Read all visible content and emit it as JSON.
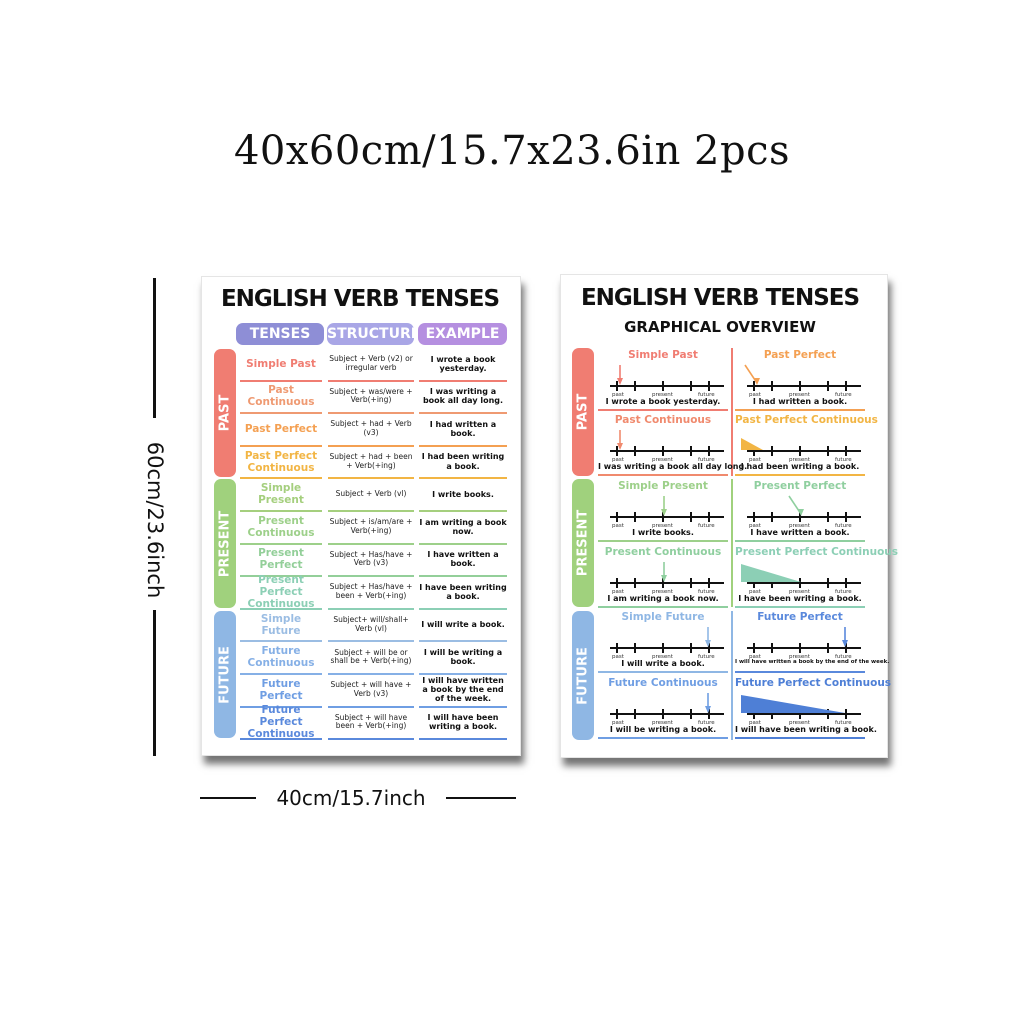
{
  "title": "40x60cm/15.7x23.6in 2pcs",
  "dim_height": "60cm/23.6inch",
  "dim_width": "40cm/15.7inch",
  "colors": {
    "past": "#f07d72",
    "present": "#9fcf82",
    "future": "#8fb7e4",
    "header_tenses": "#8e8ed6",
    "header_structure": "#a9a6e6",
    "header_example": "#b58fe0"
  },
  "poster1": {
    "title": "ENGLISH VERB TENSES",
    "headers": {
      "tenses": "TENSES",
      "structure": "STRUCTURE",
      "example": "EXAMPLE"
    },
    "groups": [
      "PAST",
      "PRESENT",
      "FUTURE"
    ],
    "rows": [
      {
        "name": "Simple Past",
        "structure": "Subject + Verb (v2) or irregular verb",
        "example": "I wrote a book yesterday."
      },
      {
        "name": "Past Continuous",
        "structure": "Subject + was/were + Verb(+ing)",
        "example": "I was writing a book all day long."
      },
      {
        "name": "Past Perfect",
        "structure": "Subject + had + Verb (v3)",
        "example": "I had written a book."
      },
      {
        "name": "Past Perfect Continuous",
        "structure": "Subject + had + been + Verb(+ing)",
        "example": "I had been writing a book."
      },
      {
        "name": "Simple Present",
        "structure": "Subject + Verb (vl)",
        "example": "I write books."
      },
      {
        "name": "Present Continuous",
        "structure": "Subject + is/am/are + Verb(+ing)",
        "example": "I am writing a book now."
      },
      {
        "name": "Present Perfect",
        "structure": "Subject + Has/have + Verb (v3)",
        "example": "I have written a book."
      },
      {
        "name": "Present Perfect Continuous",
        "structure": "Subject + Has/have + been + Verb(+ing)",
        "example": "I have been writing a book."
      },
      {
        "name": "Simple Future",
        "structure": "Subject+ will/shall+ Verb (vl)",
        "example": "I will write a book."
      },
      {
        "name": "Future Continuous",
        "structure": "Subject + will be or shall be + Verb(+ing)",
        "example": "I will be writing a book."
      },
      {
        "name": "Future Perfect",
        "structure": "Subject + will have + Verb (v3)",
        "example": "I will have written a book by the end of the week."
      },
      {
        "name": "Future Perfect Continuous",
        "structure": "Subject + will have been + Verb(+ing)",
        "example": "I will have been writing a book."
      }
    ]
  },
  "poster2": {
    "title": "ENGLISH VERB TENSES",
    "subtitle": "GRAPHICAL OVERVIEW",
    "groups": [
      "PAST",
      "PRESENT",
      "FUTURE"
    ],
    "timeline_labels": {
      "past": "past",
      "present": "present",
      "future": "future"
    },
    "cells": [
      {
        "name": "Simple Past",
        "example": "I wrote a book yesterday."
      },
      {
        "name": "Past Perfect",
        "example": "I had written a book."
      },
      {
        "name": "Past Continuous",
        "example": "I was writing a book all day long."
      },
      {
        "name": "Past Perfect Continuous",
        "example": "I had been writing a book."
      },
      {
        "name": "Simple Present",
        "example": "I write books."
      },
      {
        "name": "Present Perfect",
        "example": "I have written a book."
      },
      {
        "name": "Present Continuous",
        "example": "I am writing a book now."
      },
      {
        "name": "Present Perfect Continuous",
        "example": "I have been writing a book."
      },
      {
        "name": "Simple Future",
        "example": "I will write a book."
      },
      {
        "name": "Future Perfect",
        "example": "I will have written a book by the end of the week."
      },
      {
        "name": "Future Continuous",
        "example": "I will be writing a book."
      },
      {
        "name": "Future Perfect Continuous",
        "example": "I will have been writing a book."
      }
    ]
  }
}
